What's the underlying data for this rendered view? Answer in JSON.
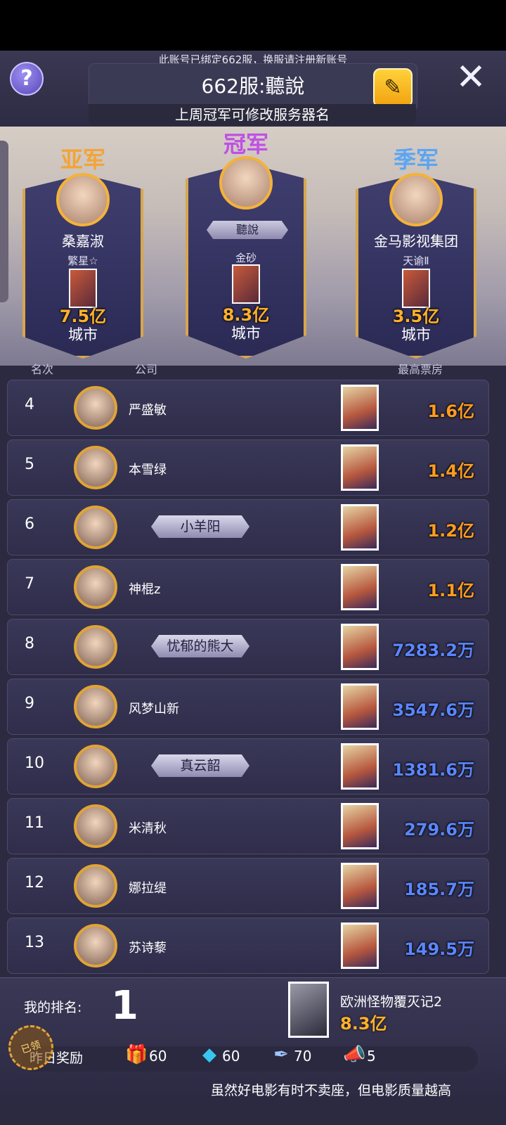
{
  "header": {
    "notice": "此账号已绑定662服，换服请注册新账号",
    "server_name": "662服:聽說",
    "server_hint": "上周冠军可修改服务器名",
    "help_icon": "?",
    "edit_icon": "✎",
    "close_icon": "✕"
  },
  "podium": {
    "second": {
      "title": "亚军",
      "name": "桑嘉淑",
      "movie": "繁星☆",
      "value": "7.5亿",
      "city": "城市"
    },
    "first": {
      "title": "冠军",
      "name": "聽說",
      "movie": "金砂",
      "value": "8.3亿",
      "city": "城市"
    },
    "third": {
      "title": "季军",
      "name": "金马影视集团",
      "movie": "天谕Ⅱ",
      "value": "3.5亿",
      "city": "城市"
    }
  },
  "columns": {
    "rank": "名次",
    "company": "公司",
    "box_office": "最高票房"
  },
  "rows": [
    {
      "rank": "4",
      "name": "严盛敏",
      "value": "1.6亿",
      "tag": false
    },
    {
      "rank": "5",
      "name": "本雪绿",
      "value": "1.4亿",
      "tag": false
    },
    {
      "rank": "6",
      "name": "小羊阳",
      "value": "1.2亿",
      "tag": true
    },
    {
      "rank": "7",
      "name": "神棍z",
      "value": "1.1亿",
      "tag": false
    },
    {
      "rank": "8",
      "name": "忧郁的熊大",
      "value": "7283.2万",
      "tag": true
    },
    {
      "rank": "9",
      "name": "风梦山新",
      "value": "3547.6万",
      "tag": false
    },
    {
      "rank": "10",
      "name": "真云韶",
      "value": "1381.6万",
      "tag": true
    },
    {
      "rank": "11",
      "name": "米清秋",
      "value": "279.6万",
      "tag": false
    },
    {
      "rank": "12",
      "name": "娜拉缇",
      "value": "185.7万",
      "tag": false
    },
    {
      "rank": "13",
      "name": "苏诗藜",
      "value": "149.5万",
      "tag": false
    }
  ],
  "colors": {
    "yi": "#ff9c1f",
    "wan": "#5a86ff"
  },
  "my_rank": {
    "label": "我的排名:",
    "value": "1",
    "movie": "欧洲怪物覆灭记2",
    "box_office": "8.3亿"
  },
  "rewards": {
    "label": "昨日奖励",
    "claimed": "已领",
    "items": [
      {
        "icon": "gift-icon",
        "value": "60"
      },
      {
        "icon": "diamond-icon",
        "value": "60"
      },
      {
        "icon": "quill-icon",
        "value": "70"
      },
      {
        "icon": "megaphone-icon",
        "value": "5"
      }
    ]
  },
  "ticker": "虽然好电影有时不卖座，但电影质量越高"
}
